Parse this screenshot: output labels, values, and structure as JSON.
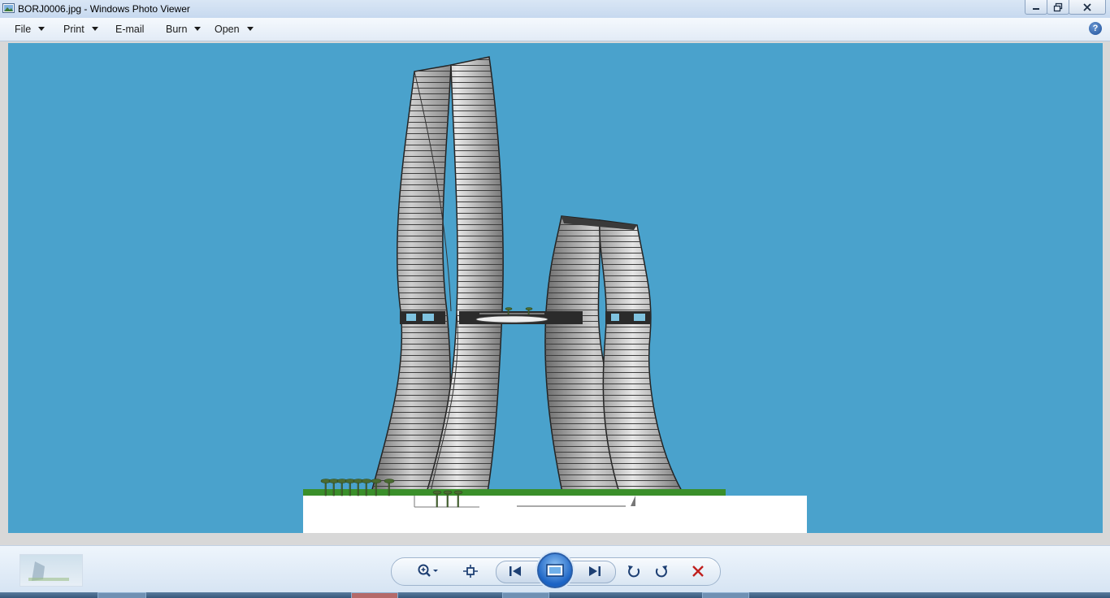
{
  "window": {
    "title": "BORJ0006.jpg - Windows Photo Viewer"
  },
  "menu": {
    "items": [
      {
        "label": "File",
        "dropdown": true
      },
      {
        "label": "Print",
        "dropdown": true
      },
      {
        "label": "E-mail",
        "dropdown": false
      },
      {
        "label": "Burn",
        "dropdown": true
      },
      {
        "label": "Open",
        "dropdown": true
      }
    ],
    "help_symbol": "?"
  },
  "photo": {
    "sky_color": "#4aa2cc",
    "base_color": "#ffffff",
    "grass_color": "#3a8f2a",
    "glass_color": "#b8b8b8"
  },
  "controls": {
    "icons": [
      "zoom-icon",
      "actual-size-icon",
      "previous-icon",
      "slideshow-icon",
      "next-icon",
      "rotate-counterclockwise-icon",
      "rotate-clockwise-icon",
      "delete-icon"
    ]
  },
  "colors": {
    "titlebar": "#c7d9ef",
    "accent_blue": "#1b63c4",
    "delete_red": "#c0201e"
  }
}
